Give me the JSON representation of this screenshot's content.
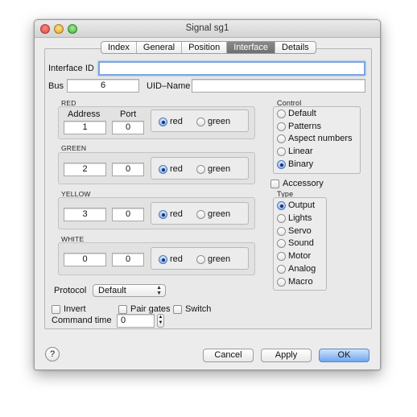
{
  "window": {
    "title": "Signal sg1"
  },
  "tabs": [
    "Index",
    "General",
    "Position",
    "Interface",
    "Details"
  ],
  "active_tab": "Interface",
  "interface": {
    "id_label": "Interface ID",
    "id_value": "",
    "bus_label": "Bus",
    "bus_value": "6",
    "uid_label": "UID–Name",
    "uid_value": ""
  },
  "aspects": {
    "address_label": "Address",
    "port_label": "Port",
    "red_option": "red",
    "green_option": "green",
    "groups": [
      {
        "title": "RED",
        "address": "1",
        "port": "0",
        "selected": "red"
      },
      {
        "title": "GREEN",
        "address": "2",
        "port": "0",
        "selected": "red"
      },
      {
        "title": "YELLOW",
        "address": "3",
        "port": "0",
        "selected": "red"
      },
      {
        "title": "WHITE",
        "address": "0",
        "port": "0",
        "selected": "red"
      }
    ]
  },
  "control": {
    "title": "Control",
    "options": [
      "Default",
      "Patterns",
      "Aspect numbers",
      "Linear",
      "Binary"
    ],
    "selected": "Binary"
  },
  "accessory_label": "Accessory",
  "type": {
    "title": "Type",
    "options": [
      "Output",
      "Lights",
      "Servo",
      "Sound",
      "Motor",
      "Analog",
      "Macro"
    ],
    "selected": "Output"
  },
  "protocol": {
    "label": "Protocol",
    "value": "Default"
  },
  "checks": {
    "invert": "Invert",
    "pair_gates": "Pair gates",
    "switch": "Switch"
  },
  "command_time": {
    "label": "Command time",
    "value": "0"
  },
  "buttons": {
    "help": "?",
    "cancel": "Cancel",
    "apply": "Apply",
    "ok": "OK"
  }
}
